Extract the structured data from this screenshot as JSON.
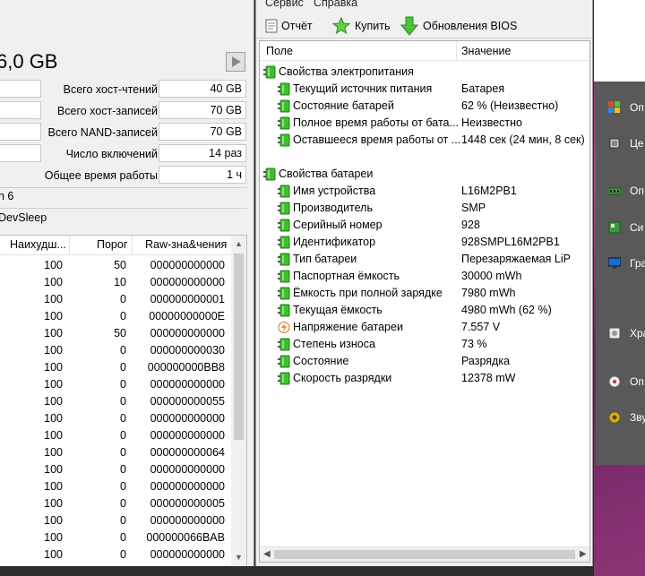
{
  "ssd": {
    "capacity": "6,0 GB",
    "stats": [
      {
        "label": "Всего хост-чтений",
        "value": "40 GB"
      },
      {
        "label": "Всего хост-записей",
        "value": "70 GB"
      },
      {
        "label": "Всего NAND-записей",
        "value": "70 GB"
      },
      {
        "label": "Число включений",
        "value": "14 раз"
      },
      {
        "label": "Общее время работы",
        "value": "1 ч"
      }
    ],
    "text1": "n 6",
    "text2": "DevSleep",
    "smart_headers": {
      "worst": "Наихудш...",
      "threshold": "Порог",
      "raw": "Raw-зна&чения"
    },
    "smart_rows": [
      {
        "worst": "100",
        "threshold": "50",
        "raw": "000000000000"
      },
      {
        "worst": "100",
        "threshold": "10",
        "raw": "000000000000"
      },
      {
        "worst": "100",
        "threshold": "0",
        "raw": "000000000001"
      },
      {
        "worst": "100",
        "threshold": "0",
        "raw": "00000000000E"
      },
      {
        "worst": "100",
        "threshold": "50",
        "raw": "000000000000"
      },
      {
        "worst": "100",
        "threshold": "0",
        "raw": "000000000030"
      },
      {
        "worst": "100",
        "threshold": "0",
        "raw": "000000000BB8"
      },
      {
        "worst": "100",
        "threshold": "0",
        "raw": "000000000000"
      },
      {
        "worst": "100",
        "threshold": "0",
        "raw": "000000000055"
      },
      {
        "worst": "100",
        "threshold": "0",
        "raw": "000000000000"
      },
      {
        "worst": "100",
        "threshold": "0",
        "raw": "000000000000"
      },
      {
        "worst": "100",
        "threshold": "0",
        "raw": "000000000064"
      },
      {
        "worst": "100",
        "threshold": "0",
        "raw": "000000000000"
      },
      {
        "worst": "100",
        "threshold": "0",
        "raw": "000000000000"
      },
      {
        "worst": "100",
        "threshold": "0",
        "raw": "000000000005"
      },
      {
        "worst": "100",
        "threshold": "0",
        "raw": "000000000000"
      },
      {
        "worst": "100",
        "threshold": "0",
        "raw": "000000066BAB"
      },
      {
        "worst": "100",
        "threshold": "0",
        "raw": "000000000000"
      }
    ]
  },
  "aida": {
    "menu": [
      "Сервис",
      "Справка"
    ],
    "toolbar": {
      "report": "Отчёт",
      "buy": "Купить",
      "bios": "Обновления BIOS"
    },
    "columns": {
      "field": "Поле",
      "value": "Значение"
    },
    "groups": [
      {
        "title": "Свойства электропитания",
        "rows": [
          {
            "name": "Текущий источник питания",
            "value": "Батарея"
          },
          {
            "name": "Состояние батарей",
            "value": "62 % (Неизвестно)"
          },
          {
            "name": "Полное время работы от бата...",
            "value": "Неизвестно"
          },
          {
            "name": "Оставшееся время работы от ...",
            "value": "1448 сек (24 мин, 8 сек)"
          }
        ]
      },
      {
        "title": "Свойства батареи",
        "rows": [
          {
            "name": "Имя устройства",
            "value": "L16M2PB1"
          },
          {
            "name": "Производитель",
            "value": "SMP"
          },
          {
            "name": "Серийный номер",
            "value": "928"
          },
          {
            "name": "Идентификатор",
            "value": "928SMPL16M2PB1"
          },
          {
            "name": "Тип батареи",
            "value": "Перезаряжаемая LiP"
          },
          {
            "name": "Паспортная ёмкость",
            "value": "30000 mWh"
          },
          {
            "name": "Ёмкость при полной зарядке",
            "value": "7980 mWh"
          },
          {
            "name": "Текущая ёмкость",
            "value": "4980 mWh  (62 %)"
          },
          {
            "name": "Напряжение батареи",
            "value": "7.557 V"
          },
          {
            "name": "Степень износа",
            "value": "73 %"
          },
          {
            "name": "Состояние",
            "value": "Разрядка"
          },
          {
            "name": "Скорость разрядки",
            "value": "12378 mW"
          }
        ]
      }
    ]
  },
  "right_menu": [
    {
      "label": "Оп",
      "icon": "windows-icon"
    },
    {
      "label": "Це",
      "icon": "chip-icon"
    },
    {
      "label": "Оп",
      "icon": "memory-icon"
    },
    {
      "label": "Си",
      "icon": "board-icon"
    },
    {
      "label": "Гра",
      "icon": "monitor-icon"
    },
    {
      "label": "Хра",
      "icon": "storage-icon"
    },
    {
      "label": "Оп",
      "icon": "disc-icon"
    },
    {
      "label": "Зву",
      "icon": "speaker-icon"
    }
  ],
  "colors": {
    "accent_green": "#2ea82e",
    "panel_dark": "#595959"
  }
}
